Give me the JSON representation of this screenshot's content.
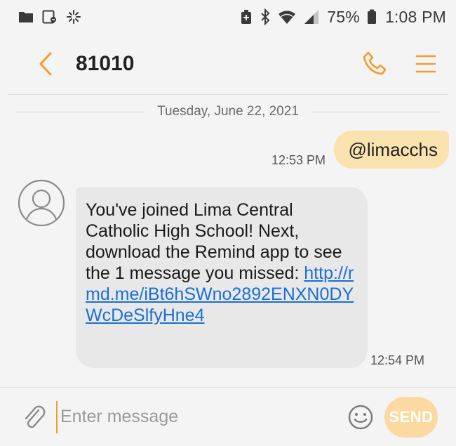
{
  "status_bar": {
    "left_icons": [
      "folder-icon",
      "gallery-icon",
      "sparkle-icon"
    ],
    "right_icons": [
      "battery-saver-icon",
      "bluetooth-icon",
      "wifi-icon",
      "signal-icon",
      "battery-icon"
    ],
    "battery_percent": "75%",
    "time": "1:08 PM"
  },
  "header": {
    "back_icon": "chevron-left-icon",
    "contact": "81010",
    "call_icon": "phone-icon",
    "menu_icon": "menu-icon",
    "accent_color": "#f39c2c"
  },
  "conversation": {
    "date": "Tuesday, June 22, 2021",
    "messages": [
      {
        "direction": "outgoing",
        "text": "@limacchs",
        "time": "12:53 PM",
        "bubble_color": "#fbe3b0"
      },
      {
        "direction": "incoming",
        "text": "You've joined Lima Central Catholic High School! Next, download the Remind app to see the 1 message you missed: ",
        "link": "http://rmd.me/iBt6hSWno2892ENXN0DYWcDeSlfyHne4",
        "time": "12:54 PM",
        "bubble_color": "#e8e8e8",
        "avatar_icon": "contact-avatar-icon"
      }
    ]
  },
  "composer": {
    "attach_icon": "paperclip-icon",
    "placeholder": "Enter message",
    "emoji_icon": "emoji-icon",
    "send_label": "SEND"
  }
}
